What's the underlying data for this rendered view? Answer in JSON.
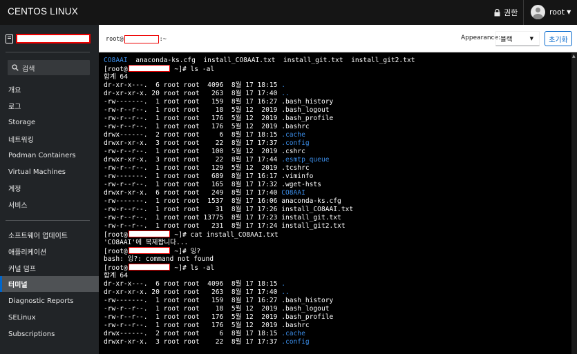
{
  "header": {
    "brand": "CENTOS LINUX",
    "permission": "권한",
    "user": "root"
  },
  "sidebar": {
    "search_placeholder": "검색",
    "items": [
      {
        "label": "개요"
      },
      {
        "label": "로그"
      },
      {
        "label": "Storage"
      },
      {
        "label": "네트워킹"
      },
      {
        "label": "Podman Containers"
      },
      {
        "label": "Virtual Machines"
      },
      {
        "label": "계정"
      },
      {
        "label": "서비스"
      },
      {
        "label": "소프트웨어 업데이트"
      },
      {
        "label": "애플리케이션"
      },
      {
        "label": "커널 덤프"
      },
      {
        "label": "터미널",
        "active": true
      },
      {
        "label": "Diagnostic Reports"
      },
      {
        "label": "SELinux"
      },
      {
        "label": "Subscriptions"
      }
    ]
  },
  "toolbar": {
    "prompt_prefix": "root@",
    "prompt_suffix": ":~",
    "appearance_label": "Appearance:",
    "appearance_value": "블랙",
    "reset_label": "초기화"
  },
  "colors": {
    "accent": "#0066cc",
    "dir_blue": "#3b8eea",
    "redact_red": "#ee0000"
  },
  "terminal": {
    "lines": [
      [
        {
          "t": "CO8AAI",
          "c": "blue"
        },
        {
          "t": "  anaconda-ks.cfg  install_CO8AAI.txt  install_git.txt  install_git2.txt"
        }
      ],
      [
        {
          "t": "[root@"
        },
        {
          "r": true
        },
        {
          "t": " ~]# ls -al"
        }
      ],
      [
        {
          "t": "합계 64"
        }
      ],
      [
        {
          "t": "dr-xr-x---.  6 root root  4096  8월 17 18:15 "
        },
        {
          "t": ".",
          "c": "blue"
        }
      ],
      [
        {
          "t": "dr-xr-xr-x. 20 root root   263  8월 17 17:40 "
        },
        {
          "t": "..",
          "c": "blue"
        }
      ],
      [
        {
          "t": "-rw-------.  1 root root   159  8월 17 16:27 .bash_history"
        }
      ],
      [
        {
          "t": "-rw-r--r--.  1 root root    18  5월 12  2019 .bash_logout"
        }
      ],
      [
        {
          "t": "-rw-r--r--.  1 root root   176  5월 12  2019 .bash_profile"
        }
      ],
      [
        {
          "t": "-rw-r--r--.  1 root root   176  5월 12  2019 .bashrc"
        }
      ],
      [
        {
          "t": "drwx------.  2 root root     6  8월 17 18:15 "
        },
        {
          "t": ".cache",
          "c": "blue"
        }
      ],
      [
        {
          "t": "drwxr-xr-x.  3 root root    22  8월 17 17:37 "
        },
        {
          "t": ".config",
          "c": "blue"
        }
      ],
      [
        {
          "t": "-rw-r--r--.  1 root root   100  5월 12  2019 .cshrc"
        }
      ],
      [
        {
          "t": "drwxr-xr-x.  3 root root    22  8월 17 17:44 "
        },
        {
          "t": ".esmtp_queue",
          "c": "blue"
        }
      ],
      [
        {
          "t": "-rw-r--r--.  1 root root   129  5월 12  2019 .tcshrc"
        }
      ],
      [
        {
          "t": "-rw-------.  1 root root   689  8월 17 16:17 .viminfo"
        }
      ],
      [
        {
          "t": "-rw-r--r--.  1 root root   165  8월 17 17:32 .wget-hsts"
        }
      ],
      [
        {
          "t": "drwxr-xr-x.  6 root root   249  8월 17 17:40 "
        },
        {
          "t": "CO8AAI",
          "c": "blue"
        }
      ],
      [
        {
          "t": "-rw-------.  1 root root  1537  8월 17 16:06 anaconda-ks.cfg"
        }
      ],
      [
        {
          "t": "-rw-r--r--.  1 root root    31  8월 17 17:26 install_CO8AAI.txt"
        }
      ],
      [
        {
          "t": "-rw-r--r--.  1 root root 13775  8월 17 17:23 install_git.txt"
        }
      ],
      [
        {
          "t": "-rw-r--r--.  1 root root   231  8월 17 17:24 install_git2.txt"
        }
      ],
      [
        {
          "t": "[root@"
        },
        {
          "r": true
        },
        {
          "t": " ~]# cat install_CO8AAI.txt"
        }
      ],
      [
        {
          "t": "'CO8AAI'에 복제합니다..."
        }
      ],
      [
        {
          "t": "[root@"
        },
        {
          "r": true
        },
        {
          "t": " ~]# 잉?"
        }
      ],
      [
        {
          "t": "bash: 잉?: command not found"
        }
      ],
      [
        {
          "t": "[root@"
        },
        {
          "r": true
        },
        {
          "t": " ~]# ls -al"
        }
      ],
      [
        {
          "t": "합계 64"
        }
      ],
      [
        {
          "t": "dr-xr-x---.  6 root root  4096  8월 17 18:15 "
        },
        {
          "t": ".",
          "c": "blue"
        }
      ],
      [
        {
          "t": "dr-xr-xr-x. 20 root root   263  8월 17 17:40 "
        },
        {
          "t": "..",
          "c": "blue"
        }
      ],
      [
        {
          "t": "-rw-------.  1 root root   159  8월 17 16:27 .bash_history"
        }
      ],
      [
        {
          "t": "-rw-r--r--.  1 root root    18  5월 12  2019 .bash_logout"
        }
      ],
      [
        {
          "t": "-rw-r--r--.  1 root root   176  5월 12  2019 .bash_profile"
        }
      ],
      [
        {
          "t": "-rw-r--r--.  1 root root   176  5월 12  2019 .bashrc"
        }
      ],
      [
        {
          "t": "drwx------.  2 root root     6  8월 17 18:15 "
        },
        {
          "t": ".cache",
          "c": "blue"
        }
      ],
      [
        {
          "t": "drwxr-xr-x.  3 root root    22  8월 17 17:37 "
        },
        {
          "t": ".config",
          "c": "blue"
        }
      ]
    ]
  }
}
